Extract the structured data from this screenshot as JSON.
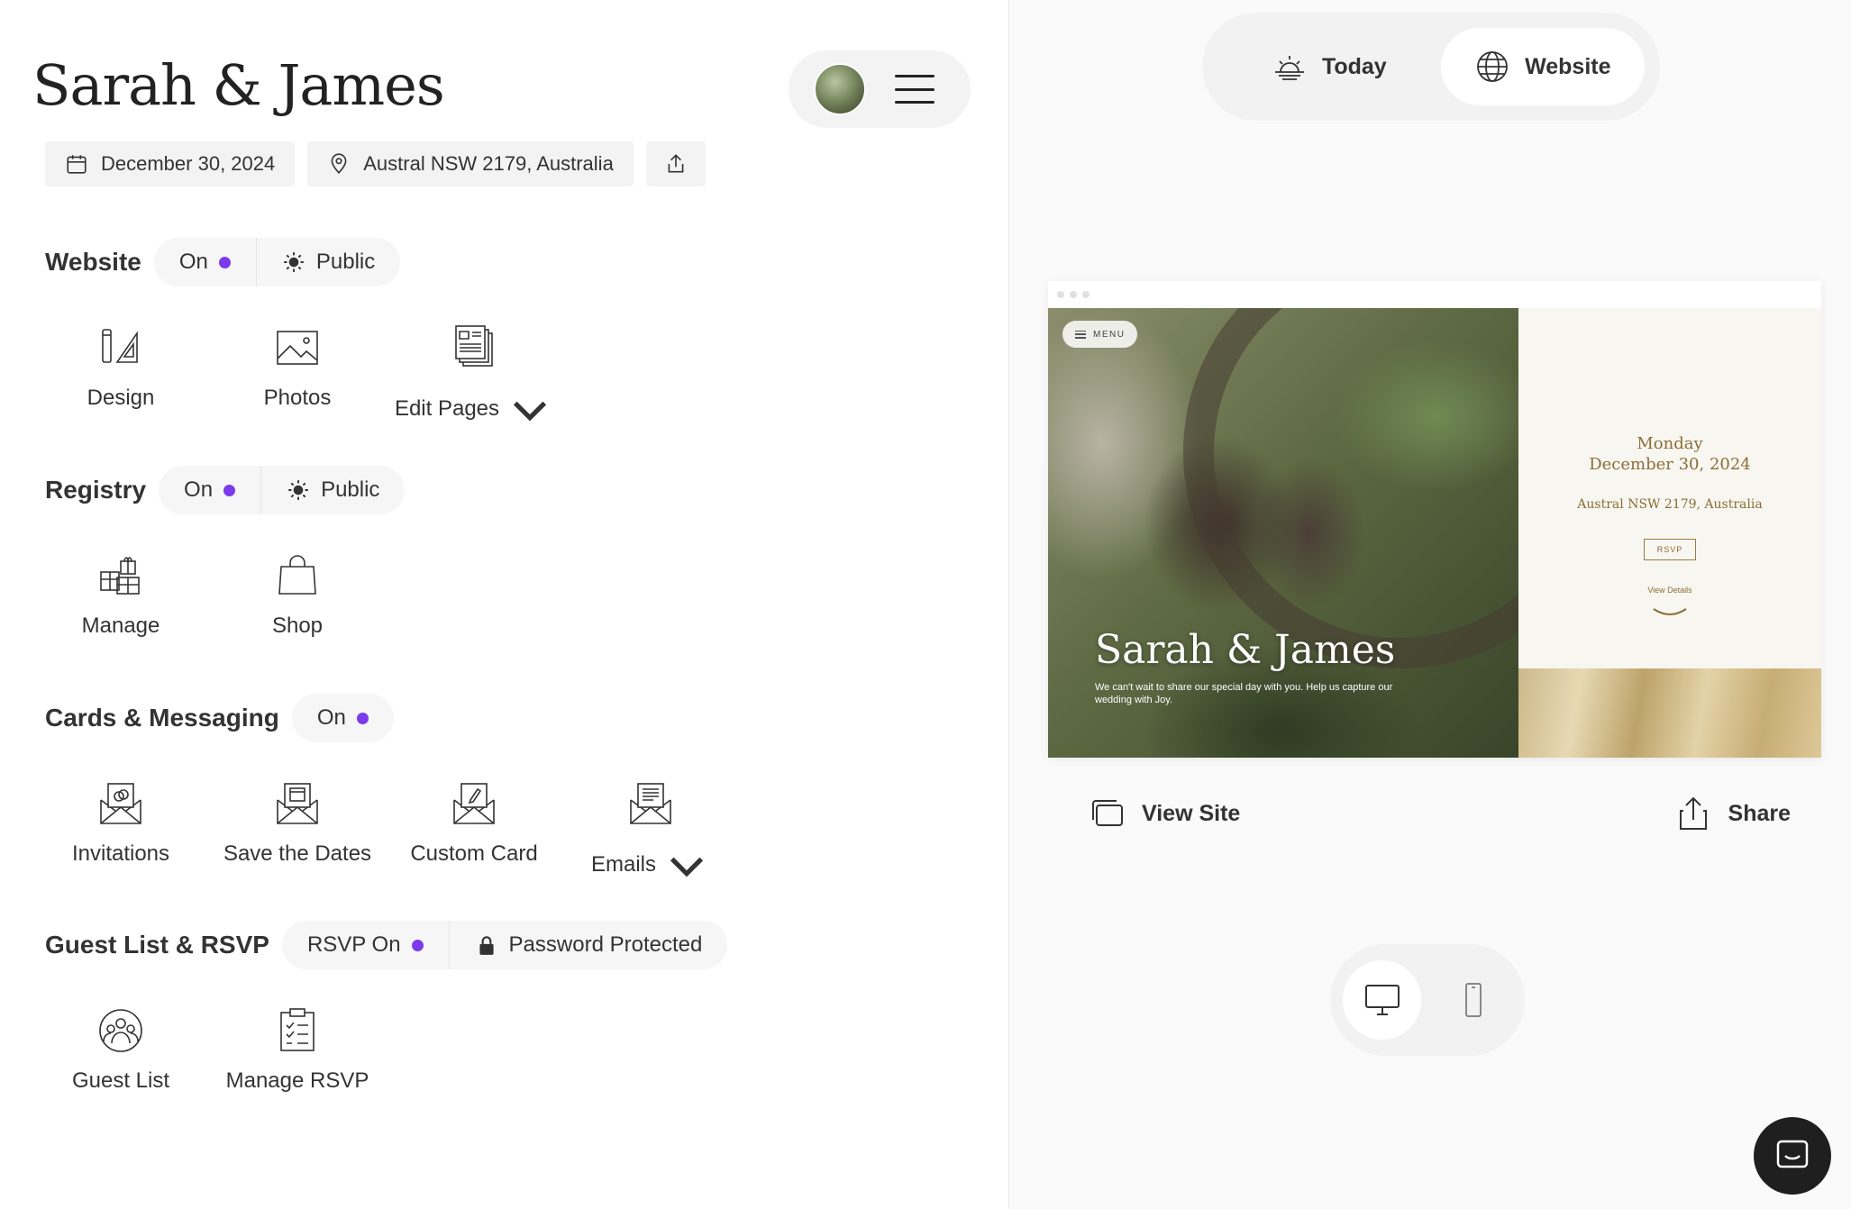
{
  "header": {
    "title": "Sarah & James",
    "date": "December 30, 2024",
    "location": "Austral NSW 2179, Australia"
  },
  "sections": {
    "website": {
      "title": "Website",
      "status": "On",
      "visibility": "Public",
      "tiles": [
        {
          "label": "Design",
          "icon": "design-tools-icon"
        },
        {
          "label": "Photos",
          "icon": "photo-icon"
        },
        {
          "label": "Edit Pages",
          "icon": "pages-icon"
        }
      ]
    },
    "registry": {
      "title": "Registry",
      "status": "On",
      "visibility": "Public",
      "tiles": [
        {
          "label": "Manage",
          "icon": "gifts-icon"
        },
        {
          "label": "Shop",
          "icon": "shopping-bag-icon"
        }
      ]
    },
    "cards": {
      "title": "Cards & Messaging",
      "status": "On",
      "tiles": [
        {
          "label": "Invitations",
          "icon": "invitation-icon"
        },
        {
          "label": "Save the Dates",
          "icon": "save-the-date-icon"
        },
        {
          "label": "Custom Card",
          "icon": "custom-card-icon"
        },
        {
          "label": "Emails",
          "icon": "email-icon"
        }
      ]
    },
    "guests": {
      "title": "Guest List & RSVP",
      "status": "RSVP On",
      "privacy": "Password Protected",
      "tiles": [
        {
          "label": "Guest List",
          "icon": "guests-icon"
        },
        {
          "label": "Manage RSVP",
          "icon": "checklist-icon"
        }
      ]
    }
  },
  "right": {
    "tabs": {
      "today": "Today",
      "website": "Website"
    },
    "preview": {
      "menu": "MENU",
      "names": "Sarah & James",
      "subtitle": "We can't wait to share our special day with you. Help us capture our wedding with Joy.",
      "day": "Monday",
      "date": "December 30, 2024",
      "location": "Austral NSW 2179, Australia",
      "rsvp": "RSVP",
      "view_details": "View Details"
    },
    "actions": {
      "view_site": "View Site",
      "share": "Share"
    }
  },
  "colors": {
    "accent": "#7c3aed",
    "gold": "#8a6d35"
  }
}
